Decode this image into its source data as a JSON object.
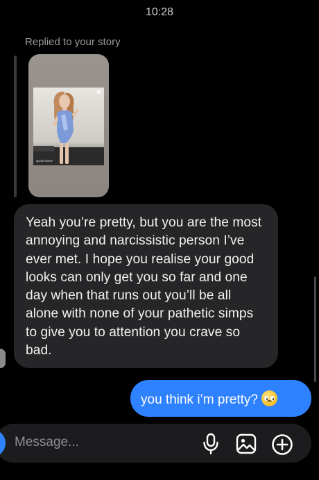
{
  "status": {
    "time": "10:28"
  },
  "reply": {
    "label": "Replied to your story",
    "story_watermark": "@username"
  },
  "messages": [
    {
      "side": "received",
      "text": "Yeah you’re pretty, but you are the most annoying and narcissistic person I’ve ever met. I hope you realise your good looks can only get you so far and one day when that runs out you’ll be all alone with none of your pathetic simps to give you to attention you crave so bad."
    },
    {
      "side": "sent",
      "text": "you think i’m pretty?",
      "emoji": "pleading-face"
    }
  ],
  "composer": {
    "placeholder": "Message...",
    "icons": [
      "camera-icon",
      "microphone-icon",
      "gallery-icon",
      "add-icon"
    ]
  },
  "colors": {
    "background": "#000000",
    "received_bubble": "#262628",
    "sent_bubble": "#2f82ff",
    "composer": "#1c1c1e"
  }
}
